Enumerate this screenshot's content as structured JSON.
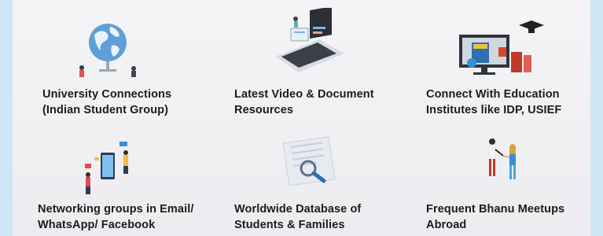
{
  "features": [
    {
      "icon": "globe-icon",
      "line1": "University Connections",
      "line2": "(Indian Student Group)"
    },
    {
      "icon": "laptop-icon",
      "line1": "Latest Video & Document",
      "line2": "Resources"
    },
    {
      "icon": "education-institute-icon",
      "line1": "Connect With Education",
      "line2": "Institutes like IDP, USIEF"
    },
    {
      "icon": "networking-phone-icon",
      "line1": "Networking groups in Email/",
      "line2": "WhatsApp/ Facebook"
    },
    {
      "icon": "database-search-icon",
      "line1": "Worldwide Database of",
      "line2": "Students & Families"
    },
    {
      "icon": "meetup-people-icon",
      "line1": "Frequent Bhanu Meetups",
      "line2": "Abroad"
    }
  ]
}
